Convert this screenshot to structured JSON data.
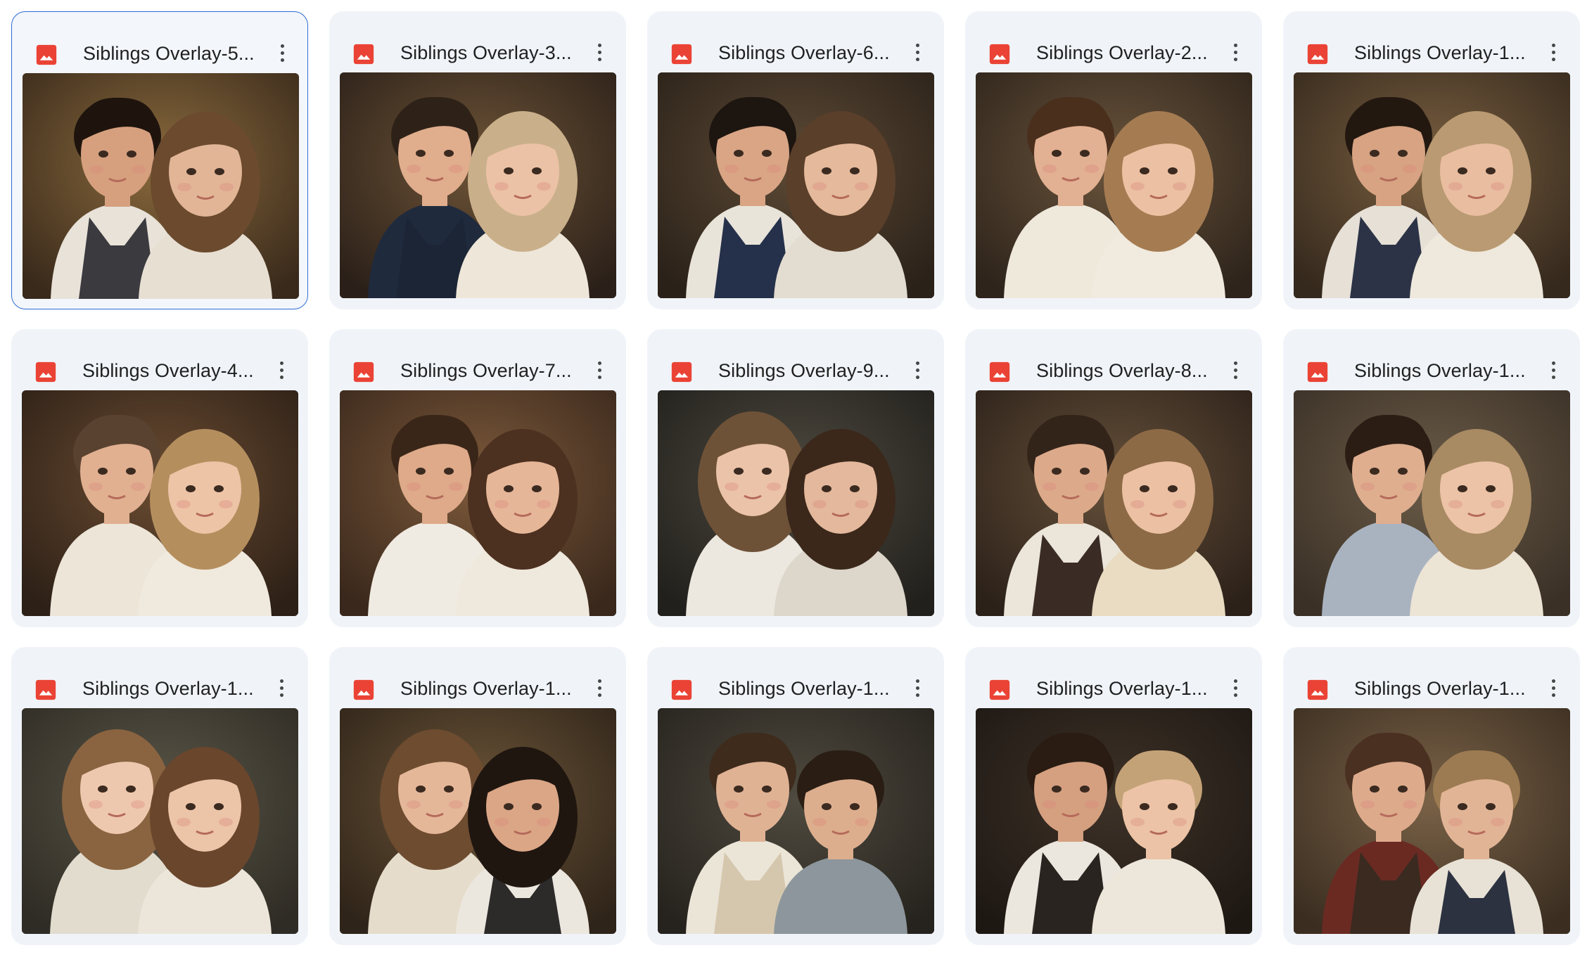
{
  "files": [
    {
      "name": "Siblings Overlay-5...",
      "selected": true,
      "scene": {
        "bg": "#3a2a1b",
        "glow": "#8a6a3d",
        "left": {
          "hair": "#1e140d",
          "skin": "#d6a07f",
          "cloth": "#e8e2d8",
          "vest": "#3a3a3f"
        },
        "right": {
          "hair": "#6b4a2e",
          "skin": "#e2b597",
          "cloth": "#e7dfd2"
        }
      }
    },
    {
      "name": "Siblings Overlay-3...",
      "selected": false,
      "scene": {
        "bg": "#2b2019",
        "glow": "#6e5437",
        "left": {
          "hair": "#2e2218",
          "skin": "#e0ad8d",
          "cloth": "#1f2a3d",
          "vest": "#1c2536"
        },
        "right": {
          "hair": "#c9b08a",
          "skin": "#ecc2a6",
          "cloth": "#eee6d9"
        }
      }
    },
    {
      "name": "Siblings Overlay-6...",
      "selected": false,
      "scene": {
        "bg": "#2a2119",
        "glow": "#5d4a35",
        "left": {
          "hair": "#1d1510",
          "skin": "#d9a585",
          "cloth": "#e9e4da",
          "vest": "#25304a"
        },
        "right": {
          "hair": "#5a3f2a",
          "skin": "#e5b99b",
          "cloth": "#e3dcd0"
        }
      }
    },
    {
      "name": "Siblings Overlay-2...",
      "selected": false,
      "scene": {
        "bg": "#2e241b",
        "glow": "#6a543c",
        "left": {
          "hair": "#4a2f1d",
          "skin": "#e2b092",
          "cloth": "#efe9dc",
          "vest": "#efe9dc"
        },
        "right": {
          "hair": "#a57c52",
          "skin": "#ecc1a3",
          "cloth": "#f1eadf"
        }
      }
    },
    {
      "name": "Siblings Overlay-1...",
      "selected": false,
      "scene": {
        "bg": "#35291d",
        "glow": "#7a5f40",
        "left": {
          "hair": "#231810",
          "skin": "#d7a382",
          "cloth": "#e6e0d6",
          "vest": "#2c3346"
        },
        "right": {
          "hair": "#b99a72",
          "skin": "#e9bda0",
          "cloth": "#efe8dc"
        }
      }
    },
    {
      "name": "Siblings Overlay-4...",
      "selected": false,
      "scene": {
        "bg": "#2d2017",
        "glow": "#6b4c31",
        "left": {
          "hair": "#5a4230",
          "skin": "#e1b091",
          "cloth": "#ece5d8",
          "vest": "#ece5d8"
        },
        "right": {
          "hair": "#b58e5e",
          "skin": "#eec4a7",
          "cloth": "#f0e9dd"
        }
      }
    },
    {
      "name": "Siblings Overlay-7...",
      "selected": false,
      "scene": {
        "bg": "#3a281c",
        "glow": "#7d5a3b",
        "left": {
          "hair": "#3a2618",
          "skin": "#deaa89",
          "cloth": "#f0ebe2",
          "vest": "#f0ebe2"
        },
        "right": {
          "hair": "#4c3020",
          "skin": "#e6b698",
          "cloth": "#efe8dc"
        }
      }
    },
    {
      "name": "Siblings Overlay-9...",
      "selected": false,
      "scene": {
        "bg": "#22201c",
        "glow": "#4e4a40",
        "left": {
          "hair": "#6e5238",
          "skin": "#ebc3a8",
          "cloth": "#ece8e0",
          "vest": "#ece8e0"
        },
        "right": {
          "hair": "#3b281b",
          "skin": "#e4b89c",
          "cloth": "#ddd6cb"
        }
      }
    },
    {
      "name": "Siblings Overlay-8...",
      "selected": false,
      "scene": {
        "bg": "#2c2119",
        "glow": "#65503a",
        "left": {
          "hair": "#33241a",
          "skin": "#dcaa8a",
          "cloth": "#ebe5da",
          "vest": "#3a2c24"
        },
        "right": {
          "hair": "#8d6a46",
          "skin": "#ebc0a3",
          "cloth": "#e9dcc2"
        }
      }
    },
    {
      "name": "Siblings Overlay-1...",
      "selected": false,
      "scene": {
        "bg": "#3a3026",
        "glow": "#6b5c48",
        "left": {
          "hair": "#2b1d14",
          "skin": "#dfae8f",
          "cloth": "#a9b3c0",
          "vest": "#a9b3c0"
        },
        "right": {
          "hair": "#a88a63",
          "skin": "#ecc3a6",
          "cloth": "#ece4d5"
        }
      }
    },
    {
      "name": "Siblings Overlay-1...",
      "selected": false,
      "scene": {
        "bg": "#2f2c25",
        "glow": "#5a5648",
        "left": {
          "hair": "#8a6440",
          "skin": "#eec8ae",
          "cloth": "#e2dccf",
          "vest": "#e2dccf"
        },
        "right": {
          "hair": "#6a462c",
          "skin": "#ecc4a8",
          "cloth": "#ece6da"
        }
      }
    },
    {
      "name": "Siblings Overlay-1...",
      "selected": false,
      "scene": {
        "bg": "#2f2419",
        "glow": "#6c5538",
        "left": {
          "hair": "#6e4c30",
          "skin": "#e5b799",
          "cloth": "#e6dccb",
          "vest": "#e6dccb"
        },
        "right": {
          "hair": "#1f1610",
          "skin": "#dba686",
          "cloth": "#ece7de",
          "vest": "#2d2a2a"
        }
      }
    },
    {
      "name": "Siblings Overlay-1...",
      "selected": false,
      "scene": {
        "bg": "#26231e",
        "glow": "#4f4a3f",
        "left": {
          "hair": "#3e2b1c",
          "skin": "#e0b294",
          "cloth": "#ebe5d8",
          "vest": "#d5c7ad"
        },
        "right": {
          "hair": "#2a1d14",
          "skin": "#ddae8e",
          "cloth": "#8c969c"
        }
      }
    },
    {
      "name": "Siblings Overlay-1...",
      "selected": false,
      "scene": {
        "bg": "#1e1813",
        "glow": "#3e3228",
        "left": {
          "hair": "#2a1c13",
          "skin": "#d5a080",
          "cloth": "#ebe6de",
          "vest": "#2a2420"
        },
        "right": {
          "hair": "#c4a277",
          "skin": "#ecc3a6",
          "cloth": "#ede7db"
        }
      }
    },
    {
      "name": "Siblings Overlay-1...",
      "selected": false,
      "scene": {
        "bg": "#3b2e21",
        "glow": "#7a6247",
        "left": {
          "hair": "#4a3020",
          "skin": "#ddab8c",
          "cloth": "#6a2a22",
          "vest": "#3a2a20"
        },
        "right": {
          "hair": "#9c7b52",
          "skin": "#e2b496",
          "cloth": "#e8e2d6",
          "vest": "#2c3240"
        }
      }
    }
  ],
  "colors": {
    "card_bg": "#f0f4f9",
    "selected_border": "#2f6bd3",
    "image_icon_red": "#ea4335",
    "title_text": "#1f1f1f",
    "menu_dots": "#444746"
  },
  "icons": {
    "file_type": "image-file-icon",
    "menu": "more-vert-icon"
  }
}
